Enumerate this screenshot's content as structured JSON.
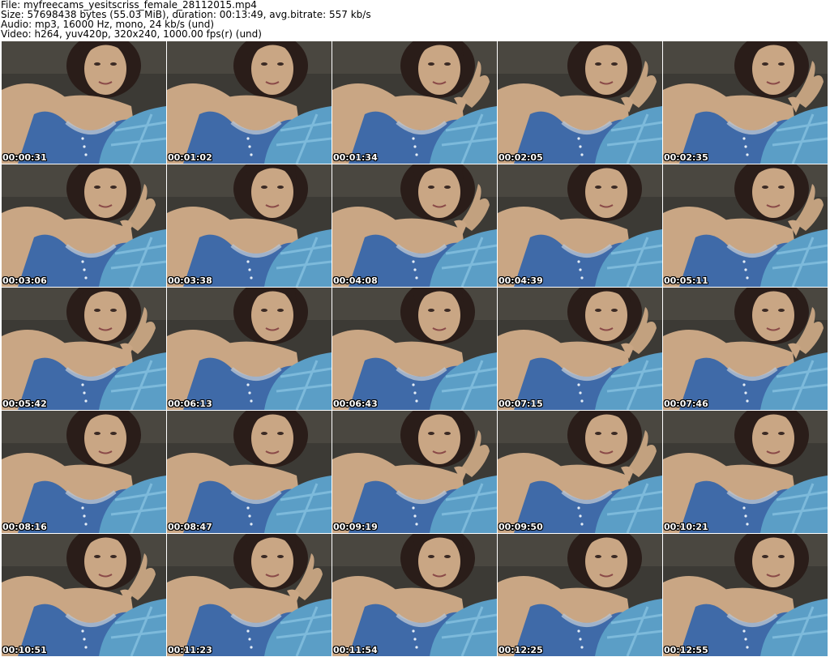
{
  "header": {
    "file_line": "File: myfreecams_yesitscriss_female_28112015.mp4",
    "size_line": "Size: 57698438 bytes (55.03 MiB), duration: 00:13:49, avg.bitrate: 557 kb/s",
    "audio_line": "Audio: mp3, 16000 Hz, mono, 24 kb/s (und)",
    "video_line": "Video: h264, yuv420p, 320x240, 1000.00 fps(r) (und)"
  },
  "colors": {
    "wall": "#3c3a35",
    "skin": "#c9a684",
    "top": "#3f6aa8",
    "pillow": "#5b9ec6",
    "hair": "#2a1d19"
  },
  "thumbnails": [
    {
      "timestamp": "00:00:31",
      "hand_raised": false
    },
    {
      "timestamp": "00:01:02",
      "hand_raised": false
    },
    {
      "timestamp": "00:01:34",
      "hand_raised": true
    },
    {
      "timestamp": "00:02:05",
      "hand_raised": true
    },
    {
      "timestamp": "00:02:35",
      "hand_raised": true
    },
    {
      "timestamp": "00:03:06",
      "hand_raised": true
    },
    {
      "timestamp": "00:03:38",
      "hand_raised": false
    },
    {
      "timestamp": "00:04:08",
      "hand_raised": true
    },
    {
      "timestamp": "00:04:39",
      "hand_raised": false
    },
    {
      "timestamp": "00:05:11",
      "hand_raised": true
    },
    {
      "timestamp": "00:05:42",
      "hand_raised": true
    },
    {
      "timestamp": "00:06:13",
      "hand_raised": false
    },
    {
      "timestamp": "00:06:43",
      "hand_raised": false
    },
    {
      "timestamp": "00:07:15",
      "hand_raised": true
    },
    {
      "timestamp": "00:07:46",
      "hand_raised": true
    },
    {
      "timestamp": "00:08:16",
      "hand_raised": false
    },
    {
      "timestamp": "00:08:47",
      "hand_raised": false
    },
    {
      "timestamp": "00:09:19",
      "hand_raised": true
    },
    {
      "timestamp": "00:09:50",
      "hand_raised": true
    },
    {
      "timestamp": "00:10:21",
      "hand_raised": false
    },
    {
      "timestamp": "00:10:51",
      "hand_raised": true
    },
    {
      "timestamp": "00:11:23",
      "hand_raised": true
    },
    {
      "timestamp": "00:11:54",
      "hand_raised": false
    },
    {
      "timestamp": "00:12:25",
      "hand_raised": false
    },
    {
      "timestamp": "00:12:55",
      "hand_raised": false
    }
  ]
}
